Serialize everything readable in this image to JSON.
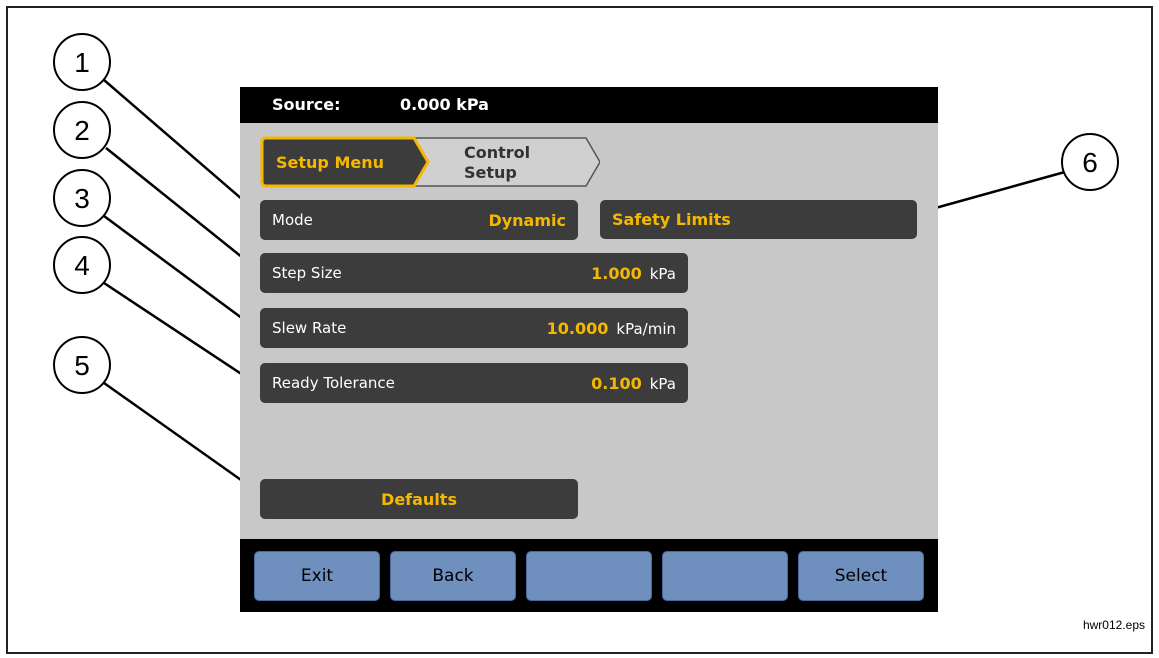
{
  "status_bar": {
    "label": "Source:",
    "value": "0.000 kPa"
  },
  "breadcrumb": {
    "active": "Setup Menu",
    "next_line1": "Control",
    "next_line2": "Setup"
  },
  "settings": {
    "mode": {
      "label": "Mode",
      "value": "Dynamic"
    },
    "step_size": {
      "label": "Step Size",
      "value": "1.000",
      "unit": "kPa"
    },
    "slew_rate": {
      "label": "Slew Rate",
      "value": "10.000",
      "unit": "kPa/min"
    },
    "ready_tolerance": {
      "label": "Ready Tolerance",
      "value": "0.100",
      "unit": "kPa"
    }
  },
  "safety_limits_label": "Safety Limits",
  "defaults_label": "Defaults",
  "softkeys": [
    "Exit",
    "Back",
    "",
    "",
    "Select"
  ],
  "callouts": [
    "1",
    "2",
    "3",
    "4",
    "5",
    "6"
  ],
  "figure_id": "hwr012.eps",
  "colors": {
    "accent": "#f5b800",
    "row_bg": "#3c3c3c",
    "screen_bg": "#c8c8c8",
    "softkey": "#6f8fbf"
  }
}
